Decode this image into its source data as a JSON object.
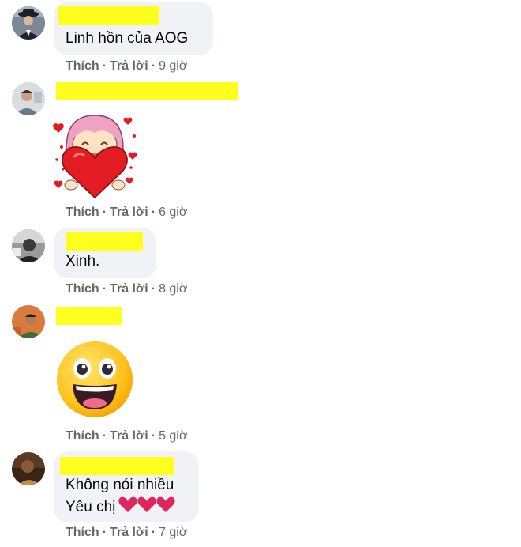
{
  "comments": [
    {
      "avatar_icon": "user-avatar-suited-man",
      "text": "Linh hồn của AOG",
      "like_label": "Thích",
      "reply_label": "Trả lời",
      "time": "9 giờ"
    },
    {
      "avatar_icon": "user-avatar-man",
      "sticker": "girl-hugging-heart-sticker",
      "like_label": "Thích",
      "reply_label": "Trả lời",
      "time": "6 giờ"
    },
    {
      "avatar_icon": "user-avatar-bw",
      "text": "Xinh.",
      "like_label": "Thích",
      "reply_label": "Trả lời",
      "time": "8 giờ"
    },
    {
      "avatar_icon": "user-avatar-orange",
      "sticker": "grinning-face-sticker",
      "like_label": "Thích",
      "reply_label": "Trả lời",
      "time": "5 giờ"
    },
    {
      "avatar_icon": "user-avatar-dark",
      "text_line1": "Không nói nhiều",
      "text_line2": "Yêu chị",
      "emoji_icon": "red-heart-emoji-x3",
      "like_label": "Thích",
      "reply_label": "Trả lời",
      "time": "7 giờ"
    }
  ],
  "colors": {
    "bubble": "#f0f2f5",
    "redaction": "#ffff1f",
    "meta_text": "#65676b",
    "heart": "#e0245e"
  }
}
